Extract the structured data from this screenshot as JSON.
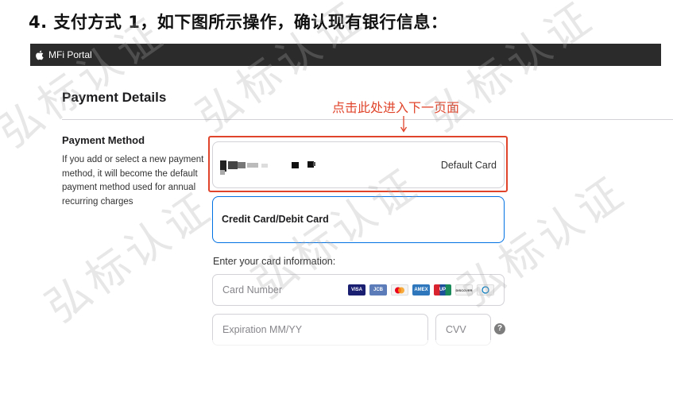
{
  "doc": {
    "step_heading": "4. 支付方式 1，如下图所示操作，确认现有银行信息："
  },
  "topbar": {
    "portal_title": "MFi Portal",
    "icon": "apple-icon"
  },
  "page": {
    "title": "Payment Details"
  },
  "annotation": {
    "text": "点击此处进入下一页面",
    "color": "#e0452c"
  },
  "payment_method": {
    "label": "Payment Method",
    "description": "If you add or select a new payment method, it will become the default payment method used for annual recurring charges",
    "saved_card": {
      "default_label": "Default Card"
    },
    "option_label": "Credit Card/Debit Card"
  },
  "card_form": {
    "intro": "Enter your card information:",
    "card_number_placeholder": "Card Number",
    "expiration_placeholder": "Expiration MM/YY",
    "cvv_placeholder": "CVV",
    "help_symbol": "?",
    "card_logos": [
      {
        "name": "visa-logo",
        "text": "VISA",
        "color": "#1a1f71"
      },
      {
        "name": "jcb-logo",
        "text": "JCB",
        "color": "#5b7cb8"
      },
      {
        "name": "mastercard-logo",
        "text": "",
        "color": "#f4f4f4"
      },
      {
        "name": "amex-logo",
        "text": "AMEX",
        "color": "#2e77bc"
      },
      {
        "name": "unionpay-logo",
        "text": "UP",
        "color": "#2c7fbf"
      },
      {
        "name": "discover-logo",
        "text": "DISCOVER",
        "color": "#f4f4f4"
      },
      {
        "name": "diners-logo",
        "text": "",
        "color": "#f4f4f4"
      }
    ]
  },
  "watermark": {
    "text": "弘标认证"
  },
  "colors": {
    "accent_blue": "#0071e3",
    "annotation_red": "#e0452c",
    "topbar": "#2b2b2b"
  }
}
